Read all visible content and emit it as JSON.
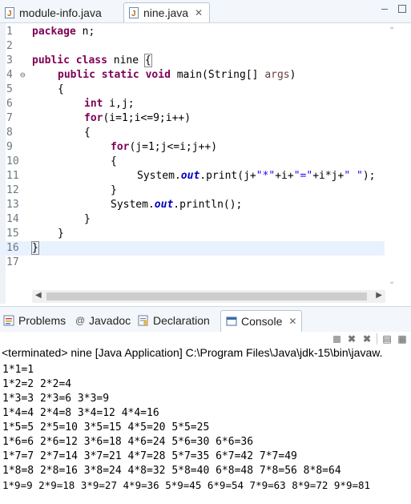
{
  "editor_tabs": [
    {
      "label": "module-info.java",
      "icon": "java-file-icon",
      "active": false
    },
    {
      "label": "nine.java",
      "icon": "java-file-icon",
      "active": true,
      "close": "✕"
    }
  ],
  "code_lines": [
    {
      "num": "1",
      "fold": ""
    },
    {
      "num": "2",
      "fold": ""
    },
    {
      "num": "3",
      "fold": ""
    },
    {
      "num": "4",
      "fold": "⊖"
    },
    {
      "num": "5",
      "fold": ""
    },
    {
      "num": "6",
      "fold": ""
    },
    {
      "num": "7",
      "fold": ""
    },
    {
      "num": "8",
      "fold": ""
    },
    {
      "num": "9",
      "fold": ""
    },
    {
      "num": "10",
      "fold": ""
    },
    {
      "num": "11",
      "fold": ""
    },
    {
      "num": "12",
      "fold": ""
    },
    {
      "num": "13",
      "fold": ""
    },
    {
      "num": "14",
      "fold": ""
    },
    {
      "num": "15",
      "fold": ""
    },
    {
      "num": "16",
      "fold": ""
    },
    {
      "num": "17",
      "fold": ""
    }
  ],
  "code": {
    "l1_kw": "package",
    "l1_rest": " n;",
    "l3_kw1": "public",
    "l3_kw2": "class",
    "l3_rest": " nine ",
    "l3_brace": "{",
    "l4_kw1": "public",
    "l4_kw2": "static",
    "l4_kw3": "void",
    "l4_rest": " main(String[] ",
    "l4_arg": "args",
    "l4_end": ")",
    "l5": "{",
    "l6_kw": "int",
    "l6_rest": " i,j;",
    "l7_kw": "for",
    "l7_rest": "(i=1;i<=9;i++)",
    "l8": "{",
    "l9_kw": "for",
    "l9_rest": "(j=1;j<=i;j++)",
    "l10": "{",
    "l11_a": "System.",
    "l11_out": "out",
    "l11_b": ".print(j+",
    "l11_s1": "\"*\"",
    "l11_c": "+i+",
    "l11_s2": "\"=\"",
    "l11_d": "+i*j+",
    "l11_s3": "\" \"",
    "l11_e": ");",
    "l12": "}",
    "l13_a": "System.",
    "l13_out": "out",
    "l13_b": ".println();",
    "l14": "}",
    "l15": "}",
    "l16": "}"
  },
  "view_tabs": [
    {
      "label": "Problems",
      "icon": "problems-icon"
    },
    {
      "label": "Javadoc",
      "icon": "javadoc-icon"
    },
    {
      "label": "Declaration",
      "icon": "declaration-icon"
    },
    {
      "label": "Console",
      "icon": "console-icon",
      "active": true,
      "close": "✕"
    }
  ],
  "console": {
    "status": "<terminated> nine [Java Application] C:\\Program Files\\Java\\jdk-15\\bin\\javaw.",
    "output": [
      "1*1=1",
      "1*2=2 2*2=4",
      "1*3=3 2*3=6 3*3=9",
      "1*4=4 2*4=8 3*4=12 4*4=16",
      "1*5=5 2*5=10 3*5=15 4*5=20 5*5=25",
      "1*6=6 2*6=12 3*6=18 4*6=24 5*6=30 6*6=36",
      "1*7=7 2*7=14 3*7=21 4*7=28 5*7=35 6*7=42 7*7=49",
      "1*8=8 2*8=16 3*8=24 4*8=32 5*8=40 6*8=48 7*8=56 8*8=64",
      "1*9=9 2*9=18 3*9=27 4*9=36 5*9=45 6*9=54 7*9=63 8*9=72 9*9=81"
    ]
  },
  "colors": {
    "keyword": "#7f0055",
    "string": "#2a00ff",
    "field": "#0000c0",
    "current_line": "#e8f2fe"
  }
}
